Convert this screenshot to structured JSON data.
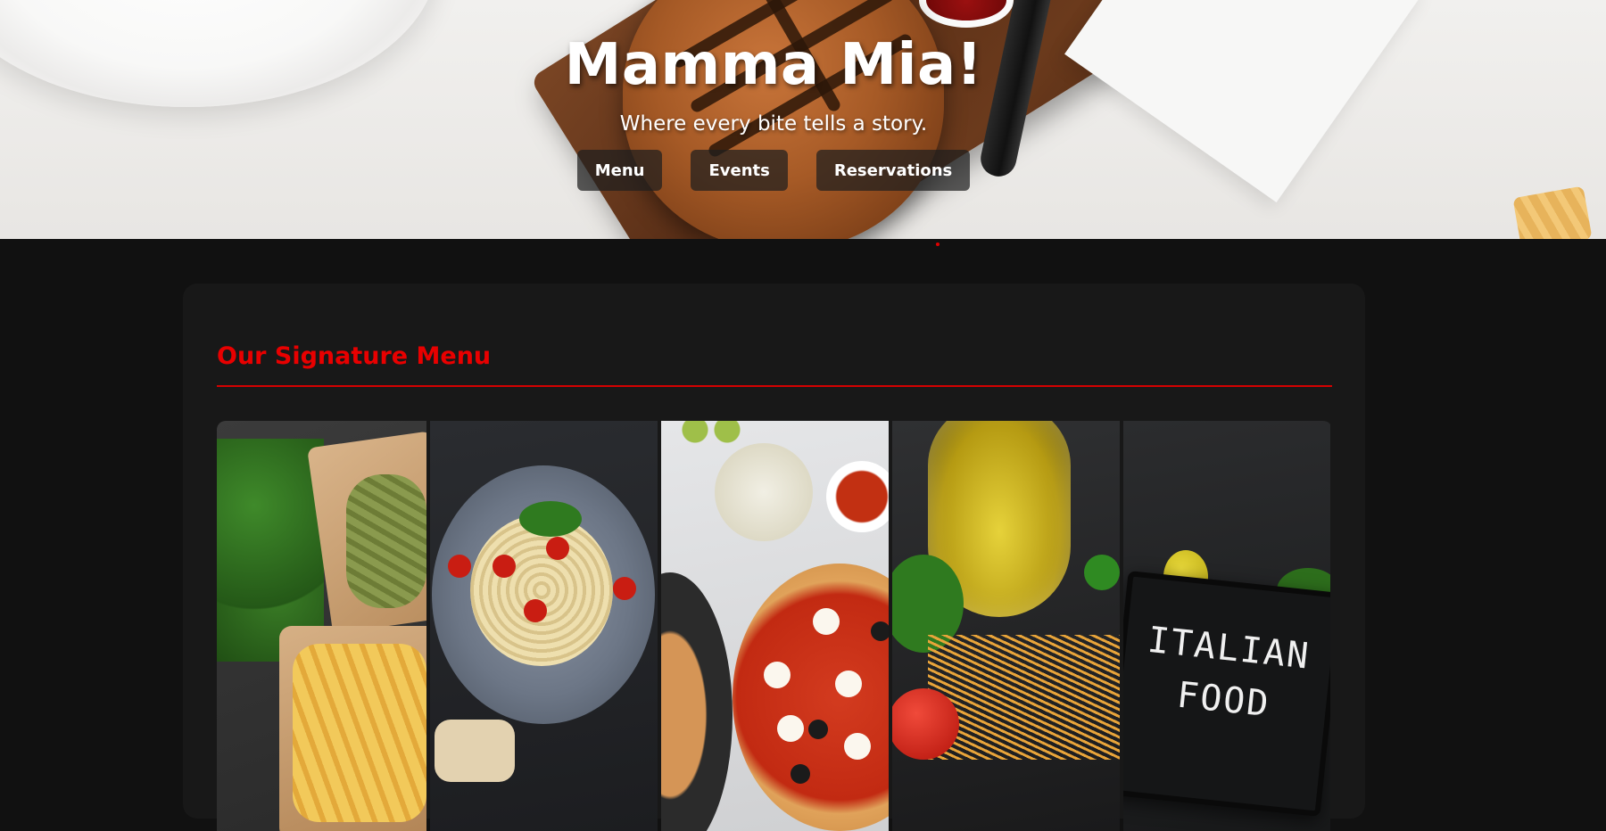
{
  "hero": {
    "title": "Mamma Mia!",
    "subtitle": "Where every bite tells a story.",
    "nav": [
      {
        "label": "Menu"
      },
      {
        "label": "Events"
      },
      {
        "label": "Reservations"
      }
    ],
    "background_image": "burger-on-cutting-board",
    "slide_indicator_color": "#e00000"
  },
  "menu_section": {
    "heading": "Our Signature Menu",
    "accent_color": "#e80000",
    "gallery": [
      {
        "image": "dry-pasta-bags"
      },
      {
        "image": "tagliatelle-plate"
      },
      {
        "image": "pizza-with-mozzarella"
      },
      {
        "image": "olive-oil-and-spaghetti"
      },
      {
        "image": "italian-food-chalkboard",
        "board_text_line1": "ITALIAN",
        "board_text_line2": "FOOD"
      }
    ]
  },
  "colors": {
    "page_background": "#111111",
    "card_background": "#181818",
    "button_background": "rgba(30,30,30,0.72)"
  }
}
